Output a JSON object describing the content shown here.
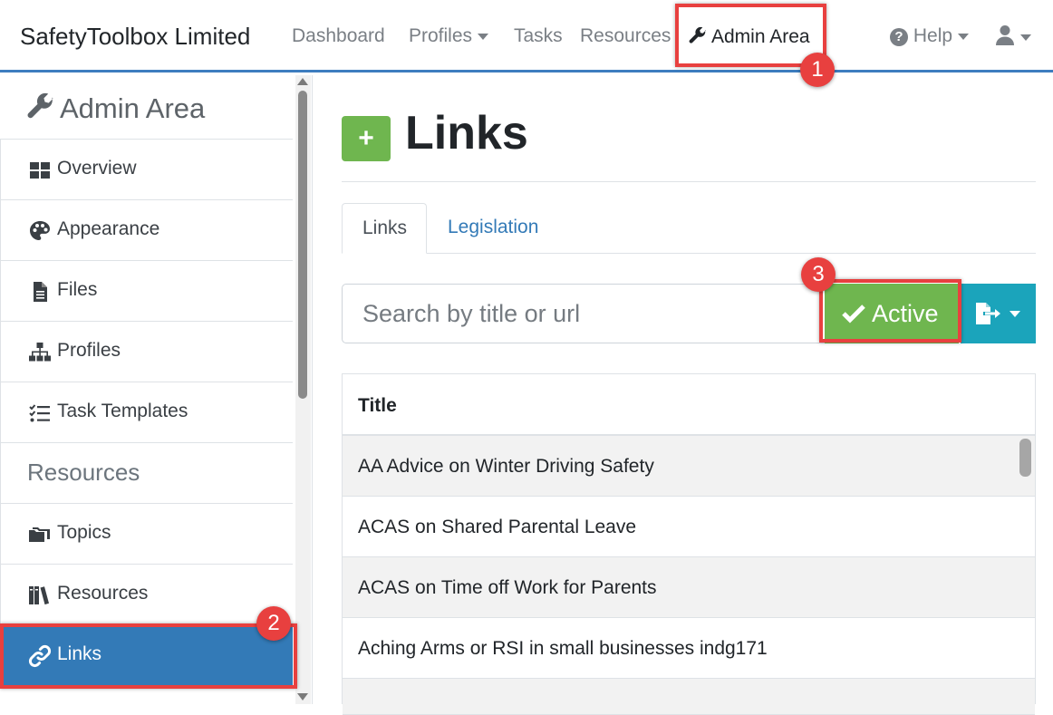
{
  "navbar": {
    "brand": "SafetyToolbox Limited",
    "items": [
      {
        "label": "Dashboard"
      },
      {
        "label": "Profiles"
      },
      {
        "label": "Tasks"
      },
      {
        "label": "Resources"
      },
      {
        "label": "Admin Area"
      }
    ],
    "help_label": "Help"
  },
  "annotations": [
    "1",
    "2",
    "3"
  ],
  "sidebar": {
    "title": "Admin Area",
    "items": [
      {
        "label": "Overview",
        "icon": "grid-icon"
      },
      {
        "label": "Appearance",
        "icon": "palette-icon"
      },
      {
        "label": "Files",
        "icon": "file-icon"
      },
      {
        "label": "Profiles",
        "icon": "sitemap-icon"
      },
      {
        "label": "Task Templates",
        "icon": "tasks-icon"
      }
    ],
    "section_header": "Resources",
    "resource_items": [
      {
        "label": "Topics",
        "icon": "folders-icon"
      },
      {
        "label": "Resources",
        "icon": "books-icon"
      },
      {
        "label": "Links",
        "icon": "link-icon",
        "active": true
      }
    ]
  },
  "main": {
    "add_symbol": "+",
    "title": "Links",
    "tabs": [
      {
        "label": "Links",
        "active": true
      },
      {
        "label": "Legislation",
        "active": false
      }
    ],
    "search_placeholder": "Search by title or url",
    "active_button_label": "Active",
    "table": {
      "header": "Title",
      "rows": [
        "AA Advice on Winter Driving Safety",
        "ACAS on Shared Parental Leave",
        "ACAS on Time off Work for Parents",
        "Aching Arms or RSI in small businesses indg171"
      ]
    }
  },
  "colors": {
    "accent_blue": "#337ab7",
    "success_green": "#6fb64f",
    "info_teal": "#1ba4bb",
    "annotation_red": "#e8403f"
  }
}
